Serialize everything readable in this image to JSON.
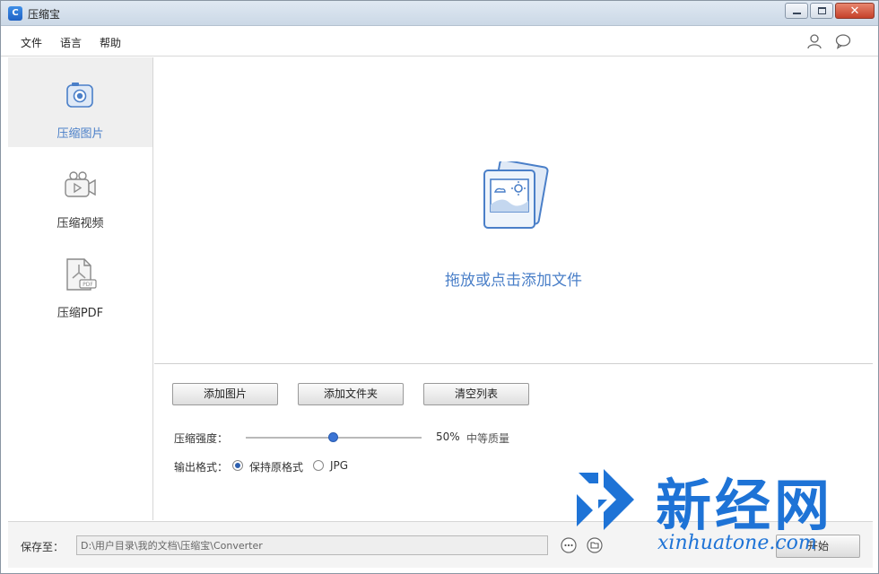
{
  "window": {
    "title": "压缩宝"
  },
  "menu": {
    "file": "文件",
    "language": "语言",
    "help": "帮助"
  },
  "sidebar": {
    "items": [
      {
        "label": "压缩图片",
        "icon": "camera-icon",
        "active": true
      },
      {
        "label": "压缩视频",
        "icon": "video-camera-icon",
        "active": false
      },
      {
        "label": "压缩PDF",
        "icon": "pdf-icon",
        "active": false
      }
    ]
  },
  "dropzone": {
    "text": "拖放或点击添加文件"
  },
  "buttons": {
    "add_image": "添加图片",
    "add_folder": "添加文件夹",
    "clear_list": "清空列表"
  },
  "compression": {
    "label": "压缩强度：",
    "value": 50,
    "value_text": "50%",
    "quality_text": "中等质量"
  },
  "output": {
    "label": "输出格式：",
    "options": [
      "保持原格式",
      "JPG"
    ],
    "selected": "保持原格式"
  },
  "save": {
    "label": "保存至：",
    "path": "D:\\用户目录\\我的文档\\压缩宝\\Converter"
  },
  "start": {
    "label": "开始"
  },
  "watermark": {
    "text": "新经网",
    "url": "xinhuatone.com"
  },
  "colors": {
    "accent": "#4a7fc8",
    "slider_thumb": "#3b74d4",
    "watermark": "#1e73d6"
  }
}
